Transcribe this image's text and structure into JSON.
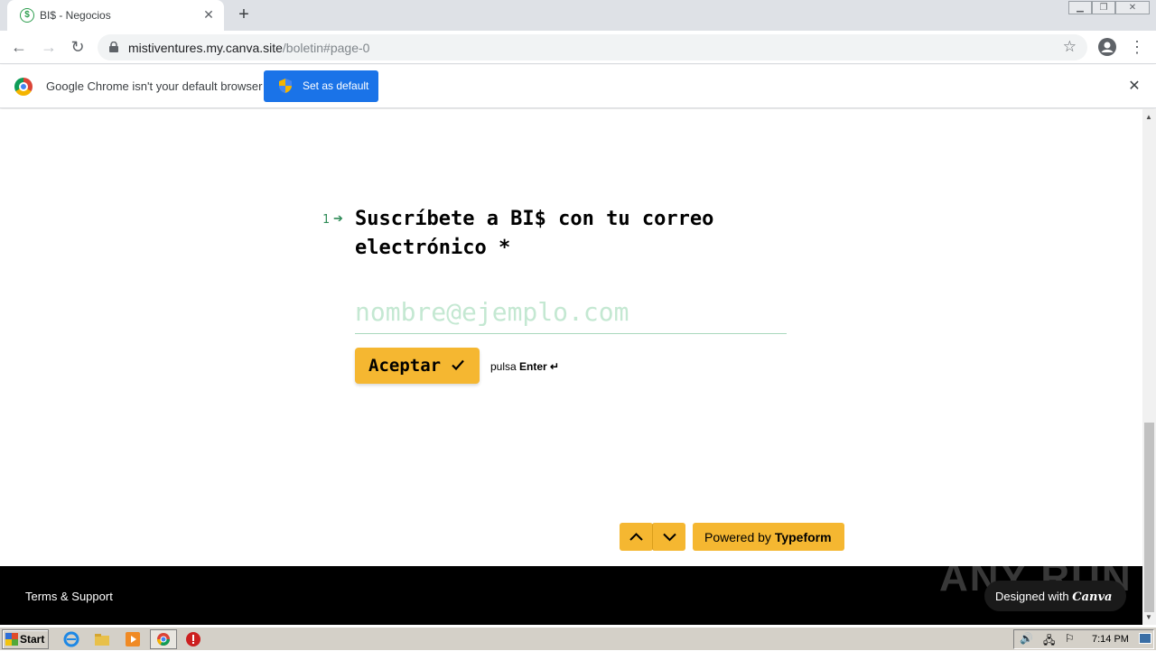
{
  "browser": {
    "tab_title": "BI$ - Negocios",
    "tab_favicon": "$",
    "url_host": "mistiventures.my.canva.site",
    "url_path": "/boletin#page-0"
  },
  "infobar": {
    "message": "Google Chrome isn't your default browser",
    "button_label": "Set as default"
  },
  "form": {
    "question_number": "1",
    "question_text": "Suscríbete a BI$ con tu correo electrónico *",
    "email_placeholder": "nombre@ejemplo.com",
    "accept_label": "Aceptar",
    "hint_prefix": "pulsa",
    "hint_key": "Enter ↵"
  },
  "badge": {
    "prefix": "Powered by ",
    "brand": "Typeform"
  },
  "footer": {
    "terms": "Terms & Support",
    "designed_prefix": "Designed with ",
    "designed_brand": "Canva",
    "watermark": "ANY RUN"
  },
  "taskbar": {
    "start_label": "Start",
    "clock": "7:14 PM"
  },
  "colors": {
    "accent": "#f5b731",
    "question_green": "#2e8b57",
    "infobar_button": "#1a73e8"
  }
}
